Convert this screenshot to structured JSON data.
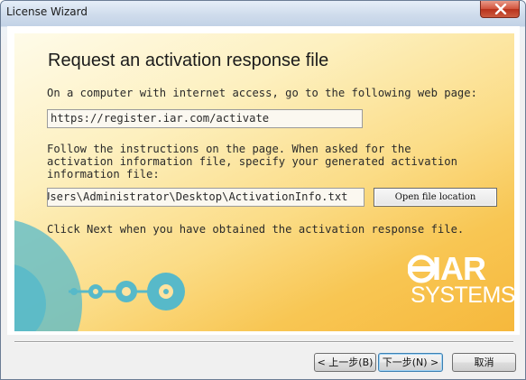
{
  "window": {
    "title": "License Wizard"
  },
  "wizard": {
    "heading": "Request an activation response file",
    "instruction_web": "On a computer with internet access, go to the following web page:",
    "url_value": "https://register.iar.com/activate",
    "instruction_follow": "Follow the instructions on the page. When asked for the\nactivation information file, specify your generated activation\ninformation file:",
    "path_value": "Users\\Administrator\\Desktop\\ActivationInfo.txt",
    "open_location_label": "Open file location",
    "instruction_next": "Click Next when you have obtained the activation response file."
  },
  "logo": {
    "name": "IAR",
    "subtitle": "SYSTEMS"
  },
  "buttons": {
    "back": "< 上一步(B)",
    "next": "下一步(N) >",
    "cancel": "取消"
  },
  "colors": {
    "panel_gradient_start": "#fefbe9",
    "panel_gradient_end": "#f6b83c",
    "teal_accent": "#57b9c9",
    "close_button": "#c94a33"
  },
  "icons": {
    "close": "close-icon",
    "decoration": "cd-disc-decoration"
  }
}
